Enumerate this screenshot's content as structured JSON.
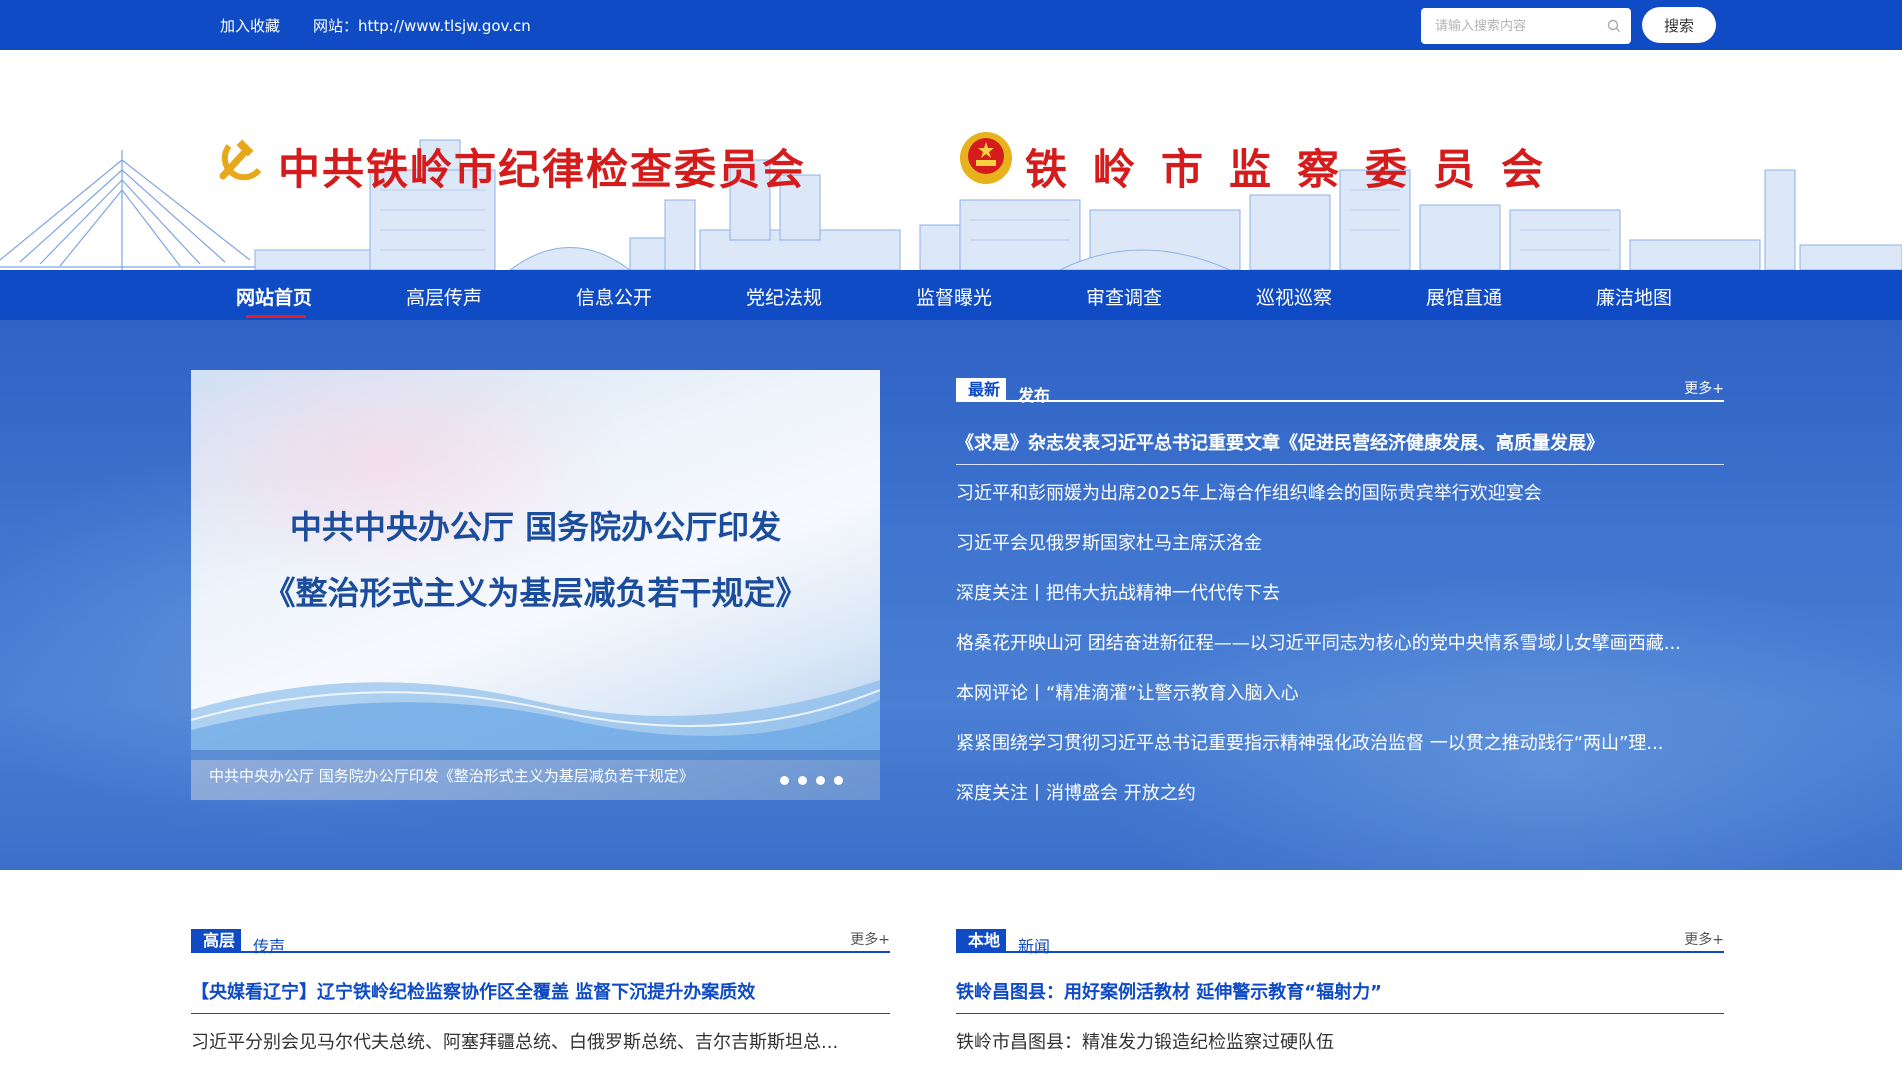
{
  "topbar": {
    "favorite": "加入收藏",
    "site_label": "网站：http://www.tlsjw.gov.cn",
    "search_placeholder": "请输入搜索内容",
    "search_button": "搜索"
  },
  "header": {
    "title_left": "中共铁岭市纪律检查委员会",
    "title_right": "铁岭市监察委员会"
  },
  "nav": {
    "items": [
      "网站首页",
      "高层传声",
      "信息公开",
      "党纪法规",
      "监督曝光",
      "审查调查",
      "巡视巡察",
      "展馆直通",
      "廉洁地图"
    ],
    "active": "网站首页"
  },
  "slider": {
    "line1": "中共中央办公厅  国务院办公厅印发",
    "line2": "《整治形式主义为基层减负若干规定》",
    "caption": "中共中央办公厅 国务院办公厅印发《整治形式主义为基层减负若干规定》",
    "slide_count": 4
  },
  "latest": {
    "tag_main": "最新",
    "tag_sub": "发布",
    "more": "更多+",
    "headline": "《求是》杂志发表习近平总书记重要文章《促进民营经济健康发展、高质量发展》",
    "items": [
      "习近平和彭丽媛为出席2025年上海合作组织峰会的国际贵宾举行欢迎宴会",
      "习近平会见俄罗斯国家杜马主席沃洛金",
      "深度关注丨把伟大抗战精神一代代传下去",
      "格桑花开映山河 团结奋进新征程——以习近平同志为核心的党中央情系雪域儿女擘画西藏...",
      "本网评论丨“精准滴灌”让警示教育入脑入心",
      "紧紧围绕学习贯彻习近平总书记重要指示精神强化政治监督 一以贯之推动践行“两山”理...",
      "深度关注丨消博盛会 开放之约"
    ]
  },
  "gaoceng": {
    "tag_main": "高层",
    "tag_sub": "传声",
    "more": "更多+",
    "headline": "【央媒看辽宁】辽宁铁岭纪检监察协作区全覆盖 监督下沉提升办案质效",
    "items": [
      "习近平分别会见马尔代夫总统、阿塞拜疆总统、白俄罗斯总统、吉尔吉斯斯坦总..."
    ]
  },
  "bendi": {
    "tag_main": "本地",
    "tag_sub": "新闻",
    "more": "更多+",
    "headline": "铁岭昌图县：用好案例活教材 延伸警示教育“辐射力”",
    "items": [
      "铁岭市昌图县：精准发力锻造纪检监察过硬队伍"
    ]
  },
  "colors": {
    "brand_blue": "#0f4bc4",
    "title_red": "#d51c1c",
    "active_underline": "#e31f1f"
  }
}
